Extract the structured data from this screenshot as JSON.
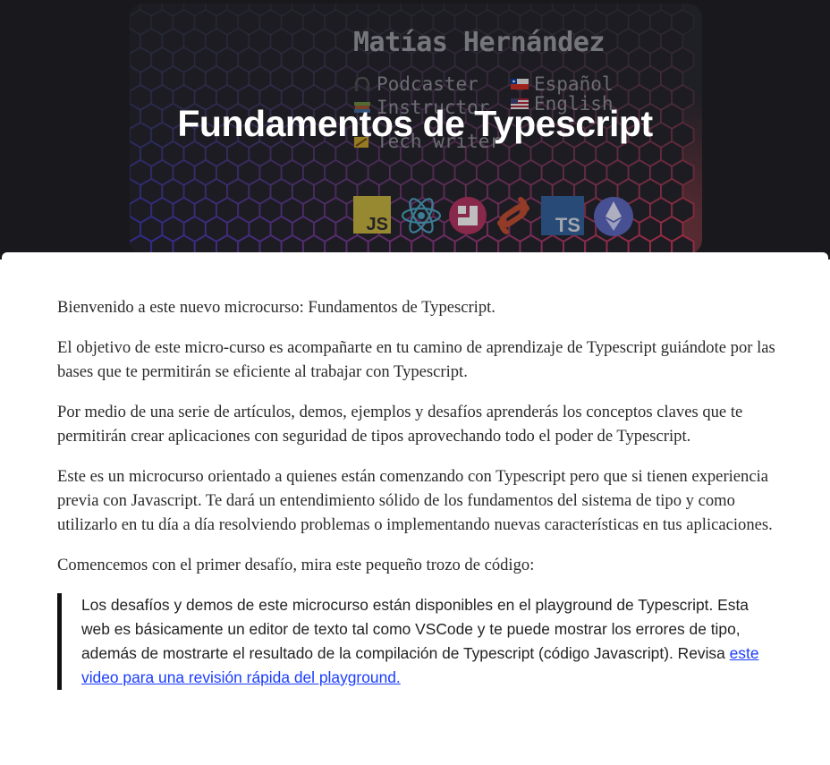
{
  "hero": {
    "author_name": "Matías Hernández",
    "roles": [
      {
        "label": "Podcaster",
        "icon": "headphones-icon"
      },
      {
        "label": "Instructor",
        "icon": "books-icon"
      },
      {
        "label": "Tech writer",
        "icon": "pencil-icon"
      }
    ],
    "languages": [
      {
        "label": "Español",
        "icon": "chile-flag-icon"
      },
      {
        "label": "English",
        "icon": "us-flag-icon"
      }
    ],
    "tech_icons": [
      {
        "name": "javascript-icon",
        "text": "JS"
      },
      {
        "name": "react-icon"
      },
      {
        "name": "jest-icon"
      },
      {
        "name": "svelte-icon"
      },
      {
        "name": "typescript-icon",
        "text": "TS"
      },
      {
        "name": "ethereum-icon"
      }
    ],
    "title": "Fundamentos de Typescript"
  },
  "article": {
    "paragraphs": [
      "Bienvenido a este nuevo microcurso: Fundamentos de Typescript.",
      "El objetivo de este micro-curso es acompañarte en tu camino de aprendizaje de Typescript guiándote por las bases que te permitirán se eficiente al trabajar con Typescript.",
      "Por medio de una serie de artículos, demos, ejemplos y desafíos aprenderás los conceptos claves que te permitirán crear aplicaciones con seguridad de tipos aprovechando todo el poder de Typescript.",
      "Este es un microcurso orientado a quienes están comenzando con Typescript pero que si tienen experiencia previa con Javascript. Te dará un entendimiento sólido de los fundamentos del sistema de tipo y como utilizarlo en tu día a día resolviendo problemas o implementando nuevas características en tus aplicaciones.",
      "Comencemos con el primer desafío, mira este pequeño trozo de código:"
    ],
    "callout": {
      "text": "Los desafíos y demos de este microcurso están disponibles en el playground de Typescript. Esta web es básicamente un editor de texto tal como VSCode y te puede mostrar los errores de tipo, además de mostrarte el resultado de la compilación de Typescript (código Javascript). Revisa ",
      "link_text": "este video para una revisión rápida del playground."
    }
  },
  "colors": {
    "link": "#1a3cff",
    "hero_background": "#1b1b1f",
    "javascript_yellow": "#f0db4f",
    "typescript_blue": "#3178c6"
  }
}
